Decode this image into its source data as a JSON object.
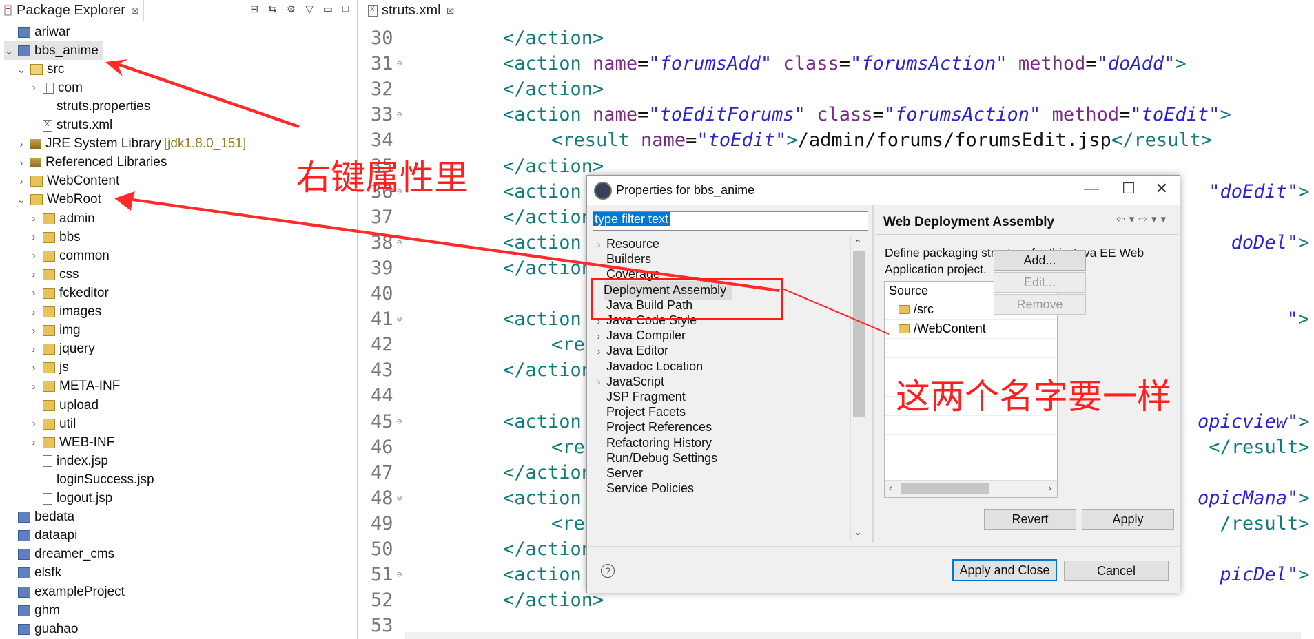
{
  "package_explorer": {
    "tab_label": "Package Explorer",
    "close_glyph": "⊠",
    "items": [
      {
        "label": "ariwar",
        "icon": "project-icon",
        "level": 0,
        "twisty": ""
      },
      {
        "label": "bbs_anime",
        "icon": "project-icon",
        "level": 0,
        "twisty": "⌄",
        "selected": true
      },
      {
        "label": "src",
        "icon": "source-folder-icon",
        "level": 1,
        "twisty": "⌄"
      },
      {
        "label": "com",
        "icon": "package-icon",
        "level": 2,
        "twisty": "›"
      },
      {
        "label": "struts.properties",
        "icon": "file-icon",
        "level": 2,
        "twisty": ""
      },
      {
        "label": "struts.xml",
        "icon": "xml-file-icon",
        "level": 2,
        "twisty": ""
      },
      {
        "label": "JRE System Library",
        "extra": "[jdk1.8.0_151]",
        "icon": "library-icon",
        "level": 1,
        "twisty": "›"
      },
      {
        "label": "Referenced Libraries",
        "icon": "library-icon",
        "level": 1,
        "twisty": "›"
      },
      {
        "label": "WebContent",
        "icon": "folder-icon",
        "level": 1,
        "twisty": "›"
      },
      {
        "label": "WebRoot",
        "icon": "folder-icon",
        "level": 1,
        "twisty": "⌄"
      },
      {
        "label": "admin",
        "icon": "folder-icon",
        "level": 2,
        "twisty": "›"
      },
      {
        "label": "bbs",
        "icon": "folder-icon",
        "level": 2,
        "twisty": "›"
      },
      {
        "label": "common",
        "icon": "folder-icon",
        "level": 2,
        "twisty": "›"
      },
      {
        "label": "css",
        "icon": "folder-icon",
        "level": 2,
        "twisty": "›"
      },
      {
        "label": "fckeditor",
        "icon": "folder-icon",
        "level": 2,
        "twisty": "›"
      },
      {
        "label": "images",
        "icon": "folder-icon",
        "level": 2,
        "twisty": "›"
      },
      {
        "label": "img",
        "icon": "folder-icon",
        "level": 2,
        "twisty": "›"
      },
      {
        "label": "jquery",
        "icon": "folder-icon",
        "level": 2,
        "twisty": "›"
      },
      {
        "label": "js",
        "icon": "folder-icon",
        "level": 2,
        "twisty": "›"
      },
      {
        "label": "META-INF",
        "icon": "folder-icon",
        "level": 2,
        "twisty": "›"
      },
      {
        "label": "upload",
        "icon": "folder-icon",
        "level": 2,
        "twisty": ""
      },
      {
        "label": "util",
        "icon": "folder-icon",
        "level": 2,
        "twisty": "›"
      },
      {
        "label": "WEB-INF",
        "icon": "folder-icon",
        "level": 2,
        "twisty": "›"
      },
      {
        "label": "index.jsp",
        "icon": "file-icon",
        "level": 2,
        "twisty": ""
      },
      {
        "label": "loginSuccess.jsp",
        "icon": "file-icon",
        "level": 2,
        "twisty": ""
      },
      {
        "label": "logout.jsp",
        "icon": "file-icon",
        "level": 2,
        "twisty": ""
      },
      {
        "label": "bedata",
        "icon": "project-icon",
        "level": 0,
        "twisty": ""
      },
      {
        "label": "dataapi",
        "icon": "project-icon",
        "level": 0,
        "twisty": ""
      },
      {
        "label": "dreamer_cms",
        "icon": "project-icon",
        "level": 0,
        "twisty": ""
      },
      {
        "label": "elsfk",
        "icon": "project-icon",
        "level": 0,
        "twisty": ""
      },
      {
        "label": "exampleProject",
        "icon": "project-icon",
        "level": 0,
        "twisty": ""
      },
      {
        "label": "ghm",
        "icon": "project-icon",
        "level": 0,
        "twisty": ""
      },
      {
        "label": "guahao",
        "icon": "project-icon",
        "level": 0,
        "twisty": ""
      }
    ]
  },
  "editor": {
    "tab_label": "struts.xml",
    "close_glyph": "⊠",
    "lines": [
      {
        "n": "30",
        "fold": false,
        "indent": 0,
        "parts": [
          [
            "tg",
            "</action>"
          ]
        ]
      },
      {
        "n": "31",
        "fold": true,
        "indent": 0,
        "parts": [
          [
            "tg",
            "<action "
          ],
          [
            "at",
            "name"
          ],
          [
            "tx",
            "="
          ],
          [
            "vl",
            "\"forumsAdd\""
          ],
          [
            "tx",
            " "
          ],
          [
            "at",
            "class"
          ],
          [
            "tx",
            "="
          ],
          [
            "vl",
            "\"forumsAction\""
          ],
          [
            "tx",
            " "
          ],
          [
            "at",
            "method"
          ],
          [
            "tx",
            "="
          ],
          [
            "vl",
            "\"doAdd\""
          ],
          [
            "tg",
            ">"
          ]
        ]
      },
      {
        "n": "32",
        "fold": false,
        "indent": 0,
        "parts": [
          [
            "tg",
            "</action>"
          ]
        ]
      },
      {
        "n": "33",
        "fold": true,
        "indent": 0,
        "parts": [
          [
            "tg",
            "<action "
          ],
          [
            "at",
            "name"
          ],
          [
            "tx",
            "="
          ],
          [
            "vl",
            "\"toEditForums\""
          ],
          [
            "tx",
            " "
          ],
          [
            "at",
            "class"
          ],
          [
            "tx",
            "="
          ],
          [
            "vl",
            "\"forumsAction\""
          ],
          [
            "tx",
            " "
          ],
          [
            "at",
            "method"
          ],
          [
            "tx",
            "="
          ],
          [
            "vl",
            "\"toEdit\""
          ],
          [
            "tg",
            ">"
          ]
        ]
      },
      {
        "n": "34",
        "fold": false,
        "indent": 1,
        "parts": [
          [
            "tg",
            "<result "
          ],
          [
            "at",
            "name"
          ],
          [
            "tx",
            "="
          ],
          [
            "vl",
            "\"toEdit\""
          ],
          [
            "tg",
            ">"
          ],
          [
            "tx",
            "/admin/forums/forumsEdit.jsp"
          ],
          [
            "tg",
            "</result>"
          ]
        ]
      },
      {
        "n": "35",
        "fold": false,
        "indent": 0,
        "parts": [
          [
            "tg",
            "</action>"
          ]
        ]
      },
      {
        "n": "36",
        "fold": true,
        "indent": 0,
        "parts": [
          [
            "tg",
            "<action"
          ]
        ],
        "tail": [
          [
            "vl",
            "\"doEdit\""
          ],
          [
            "tg",
            ">"
          ]
        ]
      },
      {
        "n": "37",
        "fold": false,
        "indent": 0,
        "parts": [
          [
            "tg",
            "</action>"
          ]
        ]
      },
      {
        "n": "38",
        "fold": true,
        "indent": 0,
        "parts": [
          [
            "tg",
            "<action"
          ]
        ],
        "tail": [
          [
            "vl",
            "doDel\""
          ],
          [
            "tg",
            ">"
          ]
        ]
      },
      {
        "n": "39",
        "fold": false,
        "indent": 0,
        "parts": [
          [
            "tg",
            "</action>"
          ]
        ]
      },
      {
        "n": "40",
        "fold": false,
        "indent": 0,
        "parts": []
      },
      {
        "n": "41",
        "fold": true,
        "indent": 0,
        "parts": [
          [
            "tg",
            "<action"
          ]
        ],
        "tail": [
          [
            "vl",
            "\""
          ],
          [
            "tg",
            ">"
          ]
        ]
      },
      {
        "n": "42",
        "fold": false,
        "indent": 1,
        "parts": [
          [
            "tg",
            "<re"
          ]
        ]
      },
      {
        "n": "43",
        "fold": false,
        "indent": 0,
        "parts": [
          [
            "tg",
            "</action>"
          ]
        ]
      },
      {
        "n": "44",
        "fold": false,
        "indent": 0,
        "parts": []
      },
      {
        "n": "45",
        "fold": true,
        "indent": 0,
        "parts": [
          [
            "tg",
            "<action"
          ]
        ],
        "tail": [
          [
            "vl",
            "opicview\""
          ],
          [
            "tg",
            ">"
          ]
        ]
      },
      {
        "n": "46",
        "fold": false,
        "indent": 1,
        "parts": [
          [
            "tg",
            "<re"
          ]
        ],
        "tail": [
          [
            "tg",
            "</result>"
          ]
        ]
      },
      {
        "n": "47",
        "fold": false,
        "indent": 0,
        "parts": [
          [
            "tg",
            "</action>"
          ]
        ]
      },
      {
        "n": "48",
        "fold": true,
        "indent": 0,
        "parts": [
          [
            "tg",
            "<action"
          ]
        ],
        "tail": [
          [
            "vl",
            "opicMana\""
          ],
          [
            "tg",
            ">"
          ]
        ]
      },
      {
        "n": "49",
        "fold": false,
        "indent": 1,
        "parts": [
          [
            "tg",
            "<re"
          ]
        ],
        "tail": [
          [
            "tg",
            "/result>"
          ]
        ]
      },
      {
        "n": "50",
        "fold": false,
        "indent": 0,
        "parts": [
          [
            "tg",
            "</action>"
          ]
        ]
      },
      {
        "n": "51",
        "fold": true,
        "indent": 0,
        "parts": [
          [
            "tg",
            "<action"
          ]
        ],
        "tail": [
          [
            "vl",
            "picDel\""
          ],
          [
            "tg",
            ">"
          ]
        ]
      },
      {
        "n": "52",
        "fold": false,
        "indent": 0,
        "parts": [
          [
            "tg",
            "</action>"
          ]
        ]
      },
      {
        "n": "53",
        "fold": false,
        "indent": 0,
        "parts": []
      }
    ]
  },
  "dialog": {
    "title": "Properties for bbs_anime",
    "minimize": "—",
    "maximize": "☐",
    "close": "✕",
    "filter_placeholder": "type filter text",
    "categories": [
      {
        "label": "Resource",
        "arrow": true
      },
      {
        "label": "Builders",
        "arrow": false
      },
      {
        "label": "Coverage",
        "arrow": false
      },
      {
        "label": "Deployment Assembly",
        "arrow": false,
        "selected": true
      },
      {
        "label": "Java Build Path",
        "arrow": false
      },
      {
        "label": "Java Code Style",
        "arrow": true
      },
      {
        "label": "Java Compiler",
        "arrow": true
      },
      {
        "label": "Java Editor",
        "arrow": true
      },
      {
        "label": "Javadoc Location",
        "arrow": false
      },
      {
        "label": "JavaScript",
        "arrow": true
      },
      {
        "label": "JSP Fragment",
        "arrow": false
      },
      {
        "label": "Project Facets",
        "arrow": false
      },
      {
        "label": "Project References",
        "arrow": false
      },
      {
        "label": "Refactoring History",
        "arrow": false
      },
      {
        "label": "Run/Debug Settings",
        "arrow": false
      },
      {
        "label": "Server",
        "arrow": false
      },
      {
        "label": "Service Policies",
        "arrow": false
      }
    ],
    "page_title": "Web Deployment Assembly",
    "description": "Define packaging structure for this Java EE Web Application project.",
    "source_header": "Source",
    "sources": [
      "/src",
      "/WebContent"
    ],
    "buttons": {
      "add": "Add...",
      "edit": "Edit...",
      "remove": "Remove",
      "revert": "Revert",
      "apply": "Apply",
      "apply_close": "Apply and Close",
      "cancel": "Cancel"
    },
    "help": "?"
  },
  "annotations": {
    "right_click_note": "右键属性里",
    "same_name_note": "这两个名字要一样",
    "color": "#ff1f1f"
  }
}
